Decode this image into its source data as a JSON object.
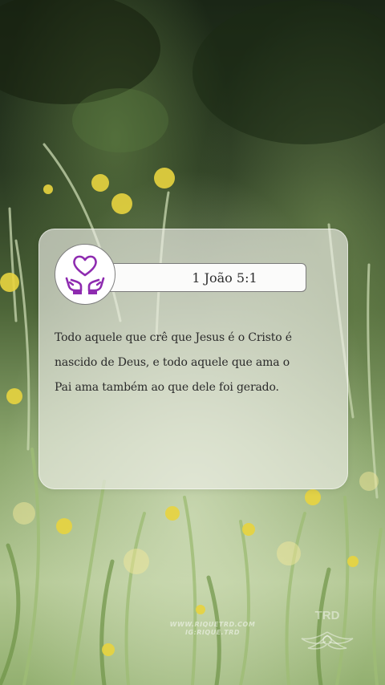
{
  "background": {
    "description_icon": "meadow-flowers-background",
    "colors": {
      "dark_green": "#1e2b1a",
      "mid_green": "#5f7a45",
      "light_green": "#a8c08a",
      "flower_yellow": "#e9d23e"
    }
  },
  "card": {
    "reference": "1 João 5:1",
    "icon": "heart-in-hands-icon",
    "icon_color": "#8e2bb0",
    "verse_lines": [
      "Todo aquele que crê que Jesus é o Cristo é",
      "nascido de Deus, e todo aquele que ama o",
      "Pai ama também ao que dele foi gerado."
    ]
  },
  "watermark": {
    "website": "WWW.RIQUETRD.COM",
    "instagram": "IG:RIQUE.TRD",
    "logo_text": "TRD",
    "logo_icon": "wings-logo-icon"
  }
}
